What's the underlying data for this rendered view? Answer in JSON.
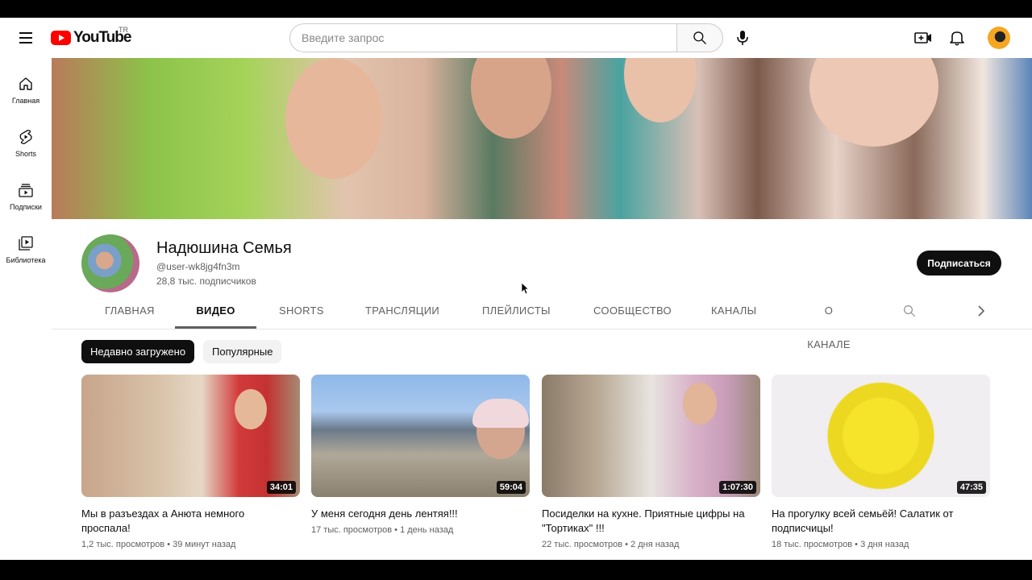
{
  "header": {
    "logo_text": "YouTube",
    "logo_country": "TR",
    "search_placeholder": "Введите запрос"
  },
  "sidebar": {
    "items": [
      {
        "label": "Главная",
        "icon": "home-icon"
      },
      {
        "label": "Shorts",
        "icon": "shorts-icon"
      },
      {
        "label": "Подписки",
        "icon": "subscriptions-icon"
      },
      {
        "label": "Библиотека",
        "icon": "library-icon"
      }
    ]
  },
  "channel": {
    "name": "Надюшина Семья",
    "handle": "@user-wk8jg4fn3m",
    "subscribers": "28,8 тыс. подписчиков",
    "subscribe_label": "Подписаться"
  },
  "tabs": [
    {
      "label": "ГЛАВНАЯ",
      "active": false
    },
    {
      "label": "ВИДЕО",
      "active": true
    },
    {
      "label": "SHORTS",
      "active": false
    },
    {
      "label": "ТРАНСЛЯЦИИ",
      "active": false
    },
    {
      "label": "ПЛЕЙЛИСТЫ",
      "active": false
    },
    {
      "label": "СООБЩЕСТВО",
      "active": false
    },
    {
      "label": "КАНАЛЫ",
      "active": false
    },
    {
      "label": "О КАНАЛЕ",
      "active": false
    }
  ],
  "chips": [
    {
      "label": "Недавно загружено",
      "selected": true
    },
    {
      "label": "Популярные",
      "selected": false
    }
  ],
  "videos": [
    {
      "duration": "34:01",
      "title_lines": [
        "Мы в разъездах а Анюта немного",
        "проспала!"
      ],
      "views": "1,2 тыс. просмотров",
      "age": "39 минут назад"
    },
    {
      "duration": "59:04",
      "title_lines": [
        "У меня сегодня день лентяя!!!"
      ],
      "views": "17 тыс. просмотров",
      "age": "1 день назад"
    },
    {
      "duration": "1:07:30",
      "title_lines": [
        "Посиделки на кухне. Приятные цифры на",
        "\"Тортиках\" !!!"
      ],
      "views": "22 тыс. просмотров",
      "age": "2 дня назад"
    },
    {
      "duration": "47:35",
      "title_lines": [
        "На прогулку всей семьёй! Салатик от",
        "подписчицы!"
      ],
      "views": "18 тыс. просмотров",
      "age": "3 дня назад"
    }
  ],
  "colors": {
    "brand_red": "#ff0000",
    "text": "#0f0f0f",
    "secondary": "#606060"
  }
}
